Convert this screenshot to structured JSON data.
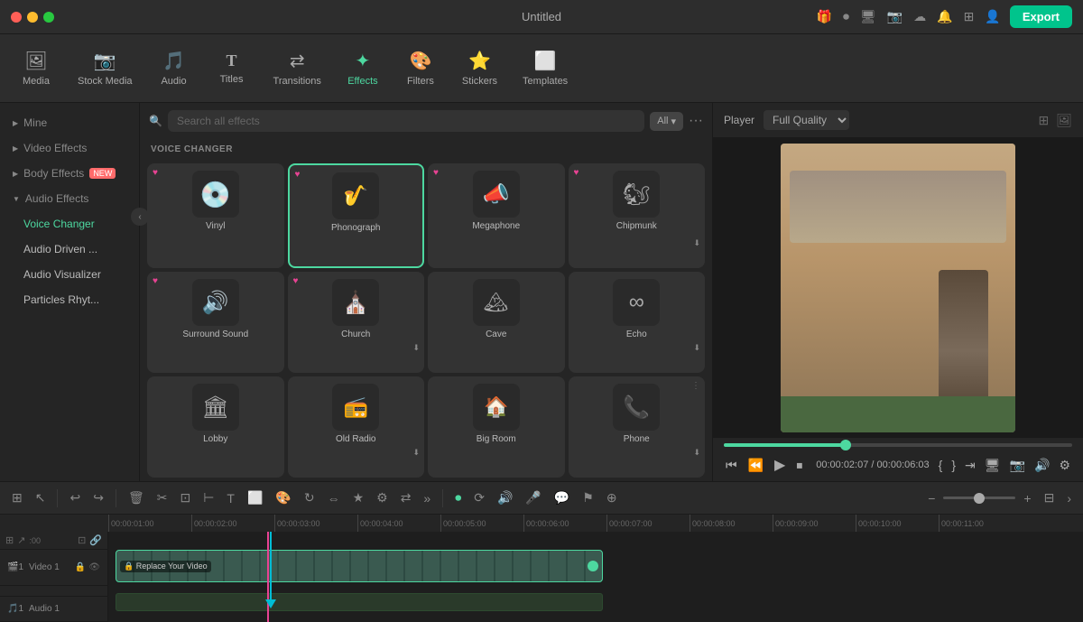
{
  "titlebar": {
    "title": "Untitled",
    "export_label": "Export"
  },
  "toolbar": {
    "items": [
      {
        "id": "media",
        "label": "Media",
        "icon": "🖼"
      },
      {
        "id": "stock",
        "label": "Stock Media",
        "icon": "📷"
      },
      {
        "id": "audio",
        "label": "Audio",
        "icon": "🎵"
      },
      {
        "id": "titles",
        "label": "Titles",
        "icon": "T"
      },
      {
        "id": "transitions",
        "label": "Transitions",
        "icon": "⇄"
      },
      {
        "id": "effects",
        "label": "Effects",
        "icon": "✦",
        "active": true
      },
      {
        "id": "filters",
        "label": "Filters",
        "icon": "🎨"
      },
      {
        "id": "stickers",
        "label": "Stickers",
        "icon": "⭐"
      },
      {
        "id": "templates",
        "label": "Templates",
        "icon": "⬜"
      }
    ]
  },
  "sidebar": {
    "items": [
      {
        "id": "mine",
        "label": "Mine",
        "type": "collapsible"
      },
      {
        "id": "video-effects",
        "label": "Video Effects",
        "type": "collapsible"
      },
      {
        "id": "body-effects",
        "label": "Body Effects",
        "type": "collapsible",
        "badge": "NEW"
      },
      {
        "id": "audio-effects",
        "label": "Audio Effects",
        "type": "collapsible",
        "expanded": true
      },
      {
        "id": "voice-changer",
        "label": "Voice Changer",
        "type": "item",
        "active": true
      },
      {
        "id": "audio-driven",
        "label": "Audio Driven ...",
        "type": "item"
      },
      {
        "id": "audio-visualizer",
        "label": "Audio Visualizer",
        "type": "item"
      },
      {
        "id": "particles-rhythm",
        "label": "Particles Rhyt...",
        "type": "item"
      }
    ]
  },
  "effects_panel": {
    "search_placeholder": "Search all effects",
    "filter_label": "All",
    "section_title": "VOICE CHANGER",
    "effects": [
      {
        "id": "vinyl",
        "label": "Vinyl",
        "icon": "💿",
        "has_heart": true,
        "selected": false
      },
      {
        "id": "phonograph",
        "label": "Phonograph",
        "icon": "🎷",
        "has_heart": true,
        "selected": true
      },
      {
        "id": "megaphone",
        "label": "Megaphone",
        "icon": "📣",
        "has_heart": true,
        "selected": false
      },
      {
        "id": "chipmunk",
        "label": "Chipmunk",
        "icon": "🐿",
        "has_heart": true,
        "selected": false,
        "has_download": true
      },
      {
        "id": "surround-sound",
        "label": "Surround Sound",
        "icon": "🔊",
        "has_heart": true,
        "selected": false
      },
      {
        "id": "church",
        "label": "Church",
        "icon": "⛪",
        "has_heart": true,
        "selected": false
      },
      {
        "id": "cave",
        "label": "Cave",
        "icon": "⛰",
        "has_heart": false,
        "selected": false
      },
      {
        "id": "echo",
        "label": "Echo",
        "icon": "∞",
        "has_heart": false,
        "selected": false,
        "has_download": true
      },
      {
        "id": "lobby",
        "label": "Lobby",
        "icon": "🏛",
        "has_heart": false,
        "selected": false
      },
      {
        "id": "old-radio",
        "label": "Old Radio",
        "icon": "📻",
        "has_heart": false,
        "selected": false,
        "has_download": true
      },
      {
        "id": "big-room",
        "label": "Big Room",
        "icon": "🏠",
        "has_heart": false,
        "selected": false
      },
      {
        "id": "phone",
        "label": "Phone",
        "icon": "📞",
        "has_heart": false,
        "selected": false,
        "has_download": true
      }
    ]
  },
  "player": {
    "label": "Player",
    "quality": "Full Quality",
    "current_time": "00:00:02:07",
    "total_time": "00:00:06:03",
    "progress_percent": 35
  },
  "timeline": {
    "markers": [
      "00:00:01:00",
      "00:00:02:00",
      "00:00:03:00",
      "00:00:04:00",
      "00:00:05:00",
      "00:00:06:00",
      "00:00:07:00",
      "00:00:08:00",
      "00:00:09:00",
      "00:00:10:00",
      "00:00:11:00"
    ],
    "tracks": [
      {
        "id": "video1",
        "label": "Video 1",
        "clip_label": "🔒 Replace Your Video"
      },
      {
        "id": "audio1",
        "label": "Audio 1"
      }
    ]
  },
  "icons": {
    "chevron_right": "▶",
    "chevron_down": "▼",
    "search": "🔍",
    "heart": "♥",
    "download": "⬇",
    "play": "▶",
    "pause": "⏸",
    "rewind": "⏮",
    "forward": "⏭",
    "stop": "⏹",
    "export": "Export"
  }
}
